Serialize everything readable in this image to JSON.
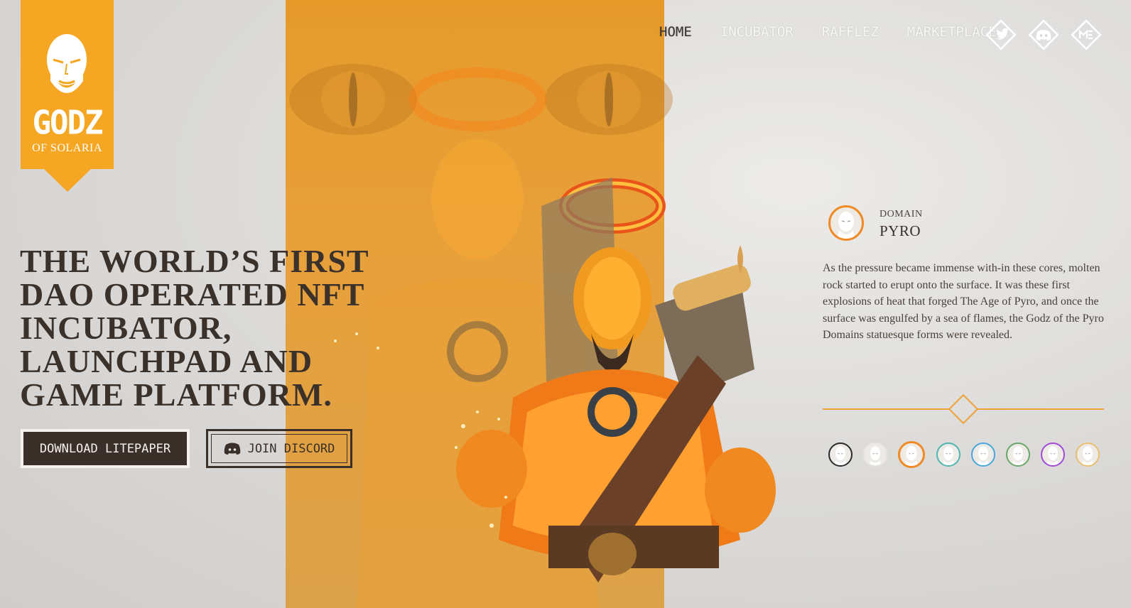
{
  "logo": {
    "title": "GODZ",
    "subtitle": "OF SOLARIA"
  },
  "nav": {
    "items": [
      {
        "label": "HOME",
        "active": true
      },
      {
        "label": "INCUBATOR",
        "active": false
      },
      {
        "label": "RAFFLEZ",
        "active": false
      },
      {
        "label": "MARKETPLACE",
        "active": false
      }
    ]
  },
  "socials": [
    "twitter-icon",
    "discord-icon",
    "magic-eden-icon"
  ],
  "hero": {
    "headline": "THE WORLD’S FIRST DAO OPERATED NFT INCUBATOR, LAUNCHPAD AND GAME PLATFORM.",
    "download_label": "DOWNLOAD LITEPAPER",
    "discord_label": "JOIN DISCORD"
  },
  "domain": {
    "label": "DOMAIN",
    "name": "PYRO",
    "description": "As the pressure became immense with-in these cores, molten rock started to erupt onto the surface. It was these first explosions of heat that forged The Age of Pyro, and once the surface was engulfed by a sea of flames, the Godz of the Pyro Domains statuesque forms were revealed."
  },
  "domain_selector": [
    {
      "name": "domain-avatar-1",
      "ring": "#2b2b2b",
      "selected": false
    },
    {
      "name": "domain-avatar-2",
      "ring": "#e8e6e3",
      "selected": false
    },
    {
      "name": "domain-avatar-pyro",
      "ring": "#f08a24",
      "selected": true
    },
    {
      "name": "domain-avatar-4",
      "ring": "#4fb6b0",
      "selected": false
    },
    {
      "name": "domain-avatar-5",
      "ring": "#4aa8e0",
      "selected": false
    },
    {
      "name": "domain-avatar-6",
      "ring": "#6aa86a",
      "selected": false
    },
    {
      "name": "domain-avatar-7",
      "ring": "#a24ad8",
      "selected": false
    },
    {
      "name": "domain-avatar-8",
      "ring": "#e8c070",
      "selected": false
    }
  ],
  "colors": {
    "brand_orange": "#f5a623",
    "dark_brown": "#3a2f29",
    "accent_line": "#f0a23a"
  }
}
